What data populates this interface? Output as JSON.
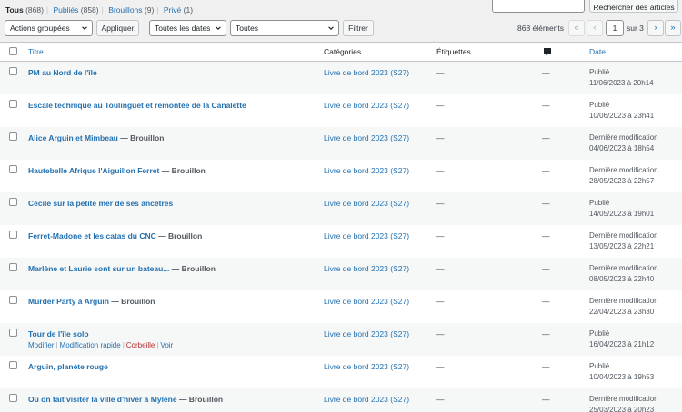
{
  "filters": [
    {
      "label": "Tous",
      "count": "(868)",
      "current": true
    },
    {
      "label": "Publiés",
      "count": "(858)",
      "current": false
    },
    {
      "label": "Brouillons",
      "count": "(9)",
      "current": false
    },
    {
      "label": "Privé",
      "count": "(1)",
      "current": false
    }
  ],
  "search": {
    "value": "",
    "button": "Rechercher des articles"
  },
  "toolbar": {
    "bulk_actions": "Actions groupées",
    "apply": "Appliquer",
    "dates": "Toutes les dates",
    "categories": "Toutes",
    "filter": "Filtrer"
  },
  "pagination": {
    "items": "868 éléments",
    "first": "«",
    "prev": "‹",
    "current_page": "1",
    "of_total": "sur 3",
    "next": "›",
    "last": "»"
  },
  "columns": {
    "title": "Titre",
    "categories": "Catégories",
    "tags": "Étiquettes",
    "date": "Date"
  },
  "row_actions": {
    "edit": "Modifier",
    "quick_edit": "Modification rapide",
    "trash": "Corbeille",
    "view": "Voir"
  },
  "posts": [
    {
      "title": "PM au Nord de l'île",
      "state": "",
      "category": "Livre de bord 2023 (S27)",
      "tags": "—",
      "comments": "—",
      "status": "Publié",
      "date": "11/06/2023 à 20h14"
    },
    {
      "title": "Escale technique au Toulinguet et remontée de la Canalette",
      "state": "",
      "category": "Livre de bord 2023 (S27)",
      "tags": "—",
      "comments": "—",
      "status": "Publié",
      "date": "10/06/2023 à 23h41"
    },
    {
      "title": "Alice Arguin et Mimbeau",
      "state": " — Brouillon",
      "category": "Livre de bord 2023 (S27)",
      "tags": "—",
      "comments": "—",
      "status": "Dernière modification",
      "date": "04/06/2023 à 18h54"
    },
    {
      "title": "Hautebelle Afrique l'Aiguillon Ferret",
      "state": " — Brouillon",
      "category": "Livre de bord 2023 (S27)",
      "tags": "—",
      "comments": "—",
      "status": "Dernière modification",
      "date": "28/05/2023 à 22h57"
    },
    {
      "title": "Cécile sur la petite mer de ses ancêtres",
      "state": "",
      "category": "Livre de bord 2023 (S27)",
      "tags": "—",
      "comments": "—",
      "status": "Publié",
      "date": "14/05/2023 à 19h01"
    },
    {
      "title": "Ferret-Madone et les catas du CNC",
      "state": " — Brouillon",
      "category": "Livre de bord 2023 (S27)",
      "tags": "—",
      "comments": "—",
      "status": "Dernière modification",
      "date": "13/05/2023 à 22h21"
    },
    {
      "title": "Marlène et Laurie sont sur un bateau...",
      "state": " — Brouillon",
      "category": "Livre de bord 2023 (S27)",
      "tags": "—",
      "comments": "—",
      "status": "Dernière modification",
      "date": "08/05/2023 à 22h40"
    },
    {
      "title": "Murder Party à Arguin",
      "state": " — Brouillon",
      "category": "Livre de bord 2023 (S27)",
      "tags": "—",
      "comments": "—",
      "status": "Dernière modification",
      "date": "22/04/2023 à 23h30"
    },
    {
      "title": "Tour de l'île solo",
      "state": "",
      "category": "Livre de bord 2023 (S27)",
      "tags": "—",
      "comments": "—",
      "status": "Publié",
      "date": "16/04/2023 à 21h12"
    },
    {
      "title": "Arguin, planète rouge",
      "state": "",
      "category": "Livre de bord 2023 (S27)",
      "tags": "—",
      "comments": "—",
      "status": "Publié",
      "date": "10/04/2023 à 19h53"
    },
    {
      "title": "Où on fait visiter la ville d'hiver à Mylène",
      "state": " — Brouillon",
      "category": "Livre de bord 2023 (S27)",
      "tags": "—",
      "comments": "—",
      "status": "Dernière modification",
      "date": "25/03/2023 à 20h23"
    }
  ]
}
